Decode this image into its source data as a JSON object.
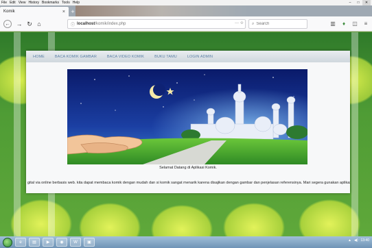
{
  "browser": {
    "menu": [
      "File",
      "Edit",
      "View",
      "History",
      "Bookmarks",
      "Tools",
      "Help"
    ],
    "tab_title": "Komik",
    "url_prefix": "localhost",
    "url_path": "/komik/index.php",
    "url_actions": "··· ☆",
    "search_placeholder": "Search"
  },
  "site": {
    "nav": [
      "HOME",
      "BACA KOMIK GAMBAR",
      "BACA VIDEO KOMIK",
      "BUKU TAMU",
      "LOGIN ADMIN"
    ],
    "caption": "Selamat Datang di Aplikasi Komik.",
    "ticker": "gital via online berbasis web. kita dapat membaca komik dengan mudah dan si komik sangat menarik karena disajikan dengan gambar dan penjelasan referensinya. Mari segera gunakan aplikasi ini dengan s"
  },
  "taskbar": {
    "clock": "13:40"
  },
  "icons": {
    "back": "back-arrow-icon",
    "forward": "forward-arrow-icon",
    "reload": "reload-icon",
    "home": "home-icon",
    "info": "info-icon",
    "search": "search-icon",
    "library": "library-icon",
    "extension": "extension-icon",
    "sidebar": "sidebar-icon",
    "menu": "hamburger-menu-icon"
  }
}
